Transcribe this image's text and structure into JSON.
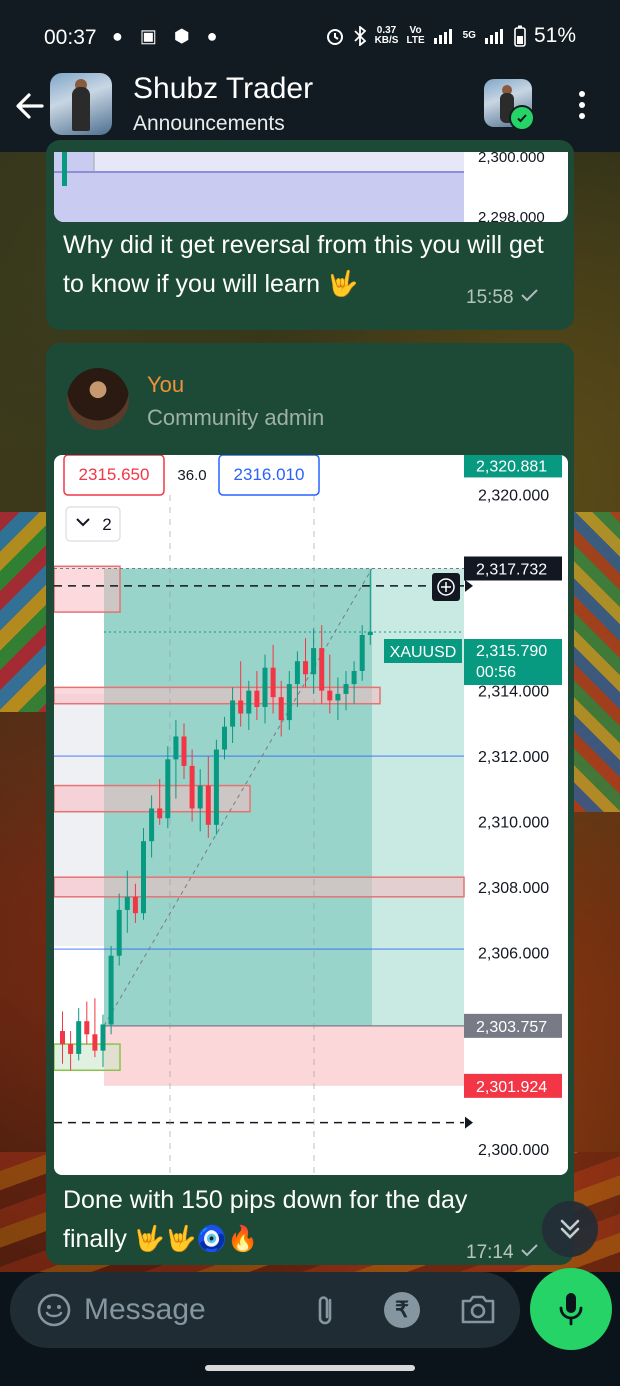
{
  "status_bar": {
    "time": "00:37",
    "network_speed": "0.37",
    "network_speed_unit": "KB/S",
    "volte_top": "Vo",
    "volte_bottom": "LTE",
    "network_type": "5G",
    "battery": "51%",
    "left_icons": "● ▣ ⬢ ●"
  },
  "header": {
    "title": "Shubz Trader",
    "subtitle": "Announcements"
  },
  "messages": [
    {
      "text": "Why did it get reversal from this you will get to know if you will learn 🤟",
      "time": "15:58",
      "partial_chart_labels": [
        "2,300.000",
        "2,298.000"
      ]
    },
    {
      "sender": "You",
      "sender_role": "Community admin",
      "text": "Done with 150 pips down for the day finally 🤟🤟🧿🔥",
      "time": "17:14",
      "chart": {
        "bid": "2315.650",
        "spread": "36.0",
        "ask": "2316.010",
        "indicator_count": "2",
        "symbol": "XAUUSD",
        "countdown": "00:56",
        "badges": {
          "top": "2,320.881",
          "target": "2,317.732",
          "current": "2,315.790",
          "entry": "2,303.757",
          "stop": "2,301.924"
        }
      }
    }
  ],
  "chart_data": {
    "type": "candlestick",
    "title": "",
    "symbol": "XAUUSD",
    "ylim": [
      2299.2,
      2321.2
    ],
    "y_ticks": [
      "2,320.000",
      "2,314.000",
      "2,312.000",
      "2,310.000",
      "2,308.000",
      "2,306.000",
      "2,300.000"
    ],
    "y_tick_values": [
      2320,
      2314,
      2312,
      2310,
      2308,
      2306,
      2300
    ],
    "price_badges": [
      {
        "label": "2,320.881",
        "value": 2320.881,
        "color": "#089981"
      },
      {
        "label": "2,317.732",
        "value": 2317.732,
        "color": "#131722"
      },
      {
        "label": "2,303.757",
        "value": 2303.757,
        "color": "#787b86"
      },
      {
        "label": "2,301.924",
        "value": 2301.924,
        "color": "#f23645"
      }
    ],
    "candles": [
      [
        2303.6,
        2304.2,
        2302.6,
        2303.2
      ],
      [
        2303.2,
        2303.6,
        2302.4,
        2302.9
      ],
      [
        2302.9,
        2304.3,
        2302.7,
        2303.9
      ],
      [
        2303.9,
        2304.5,
        2303.2,
        2303.5
      ],
      [
        2303.5,
        2304.6,
        2302.8,
        2303.0
      ],
      [
        2303.0,
        2304.1,
        2302.5,
        2303.8
      ],
      [
        2303.8,
        2306.2,
        2303.5,
        2305.9
      ],
      [
        2305.9,
        2307.8,
        2305.6,
        2307.3
      ],
      [
        2307.3,
        2308.5,
        2306.6,
        2307.7
      ],
      [
        2307.7,
        2308.1,
        2306.9,
        2307.2
      ],
      [
        2307.2,
        2309.8,
        2307.0,
        2309.4
      ],
      [
        2309.4,
        2310.8,
        2308.9,
        2310.4
      ],
      [
        2310.4,
        2311.3,
        2309.9,
        2310.1
      ],
      [
        2310.1,
        2312.3,
        2309.8,
        2311.9
      ],
      [
        2311.9,
        2313.1,
        2310.7,
        2312.6
      ],
      [
        2312.6,
        2313.0,
        2311.3,
        2311.7
      ],
      [
        2311.7,
        2312.2,
        2310.0,
        2310.4
      ],
      [
        2310.4,
        2311.6,
        2309.7,
        2311.1
      ],
      [
        2311.1,
        2312.0,
        2309.5,
        2309.9
      ],
      [
        2309.9,
        2312.5,
        2309.6,
        2312.2
      ],
      [
        2312.2,
        2313.2,
        2311.9,
        2312.9
      ],
      [
        2312.9,
        2314.1,
        2312.4,
        2313.7
      ],
      [
        2313.7,
        2314.9,
        2312.9,
        2313.3
      ],
      [
        2313.3,
        2314.3,
        2312.8,
        2314.0
      ],
      [
        2314.0,
        2314.6,
        2313.1,
        2313.5
      ],
      [
        2313.5,
        2315.1,
        2313.0,
        2314.7
      ],
      [
        2314.7,
        2315.4,
        2313.3,
        2313.8
      ],
      [
        2313.8,
        2314.3,
        2312.6,
        2313.1
      ],
      [
        2313.1,
        2314.6,
        2312.8,
        2314.2
      ],
      [
        2314.2,
        2315.2,
        2313.5,
        2314.9
      ],
      [
        2314.9,
        2315.6,
        2314.1,
        2314.5
      ],
      [
        2314.5,
        2315.9,
        2313.9,
        2315.3
      ],
      [
        2315.3,
        2316.0,
        2313.6,
        2314.0
      ],
      [
        2314.0,
        2315.1,
        2313.3,
        2313.7
      ],
      [
        2313.7,
        2314.4,
        2313.1,
        2313.9
      ],
      [
        2313.9,
        2314.6,
        2313.4,
        2314.2
      ],
      [
        2314.2,
        2314.9,
        2313.6,
        2314.6
      ],
      [
        2314.6,
        2316.0,
        2314.3,
        2315.7
      ],
      [
        2315.7,
        2317.7,
        2315.4,
        2315.8
      ]
    ],
    "zones": {
      "target": [
        2303.757,
        2317.732
      ],
      "stop": [
        2301.924,
        2303.757
      ],
      "supply_boxes": [
        [
          2316.4,
          2317.8
        ],
        [
          2313.6,
          2314.1
        ],
        [
          2310.3,
          2311.1
        ],
        [
          2307.7,
          2308.3
        ],
        [
          2302.4,
          2303.2
        ]
      ],
      "blue_lines": [
        2312.0,
        2306.1
      ]
    }
  },
  "composer": {
    "placeholder": "Message"
  }
}
